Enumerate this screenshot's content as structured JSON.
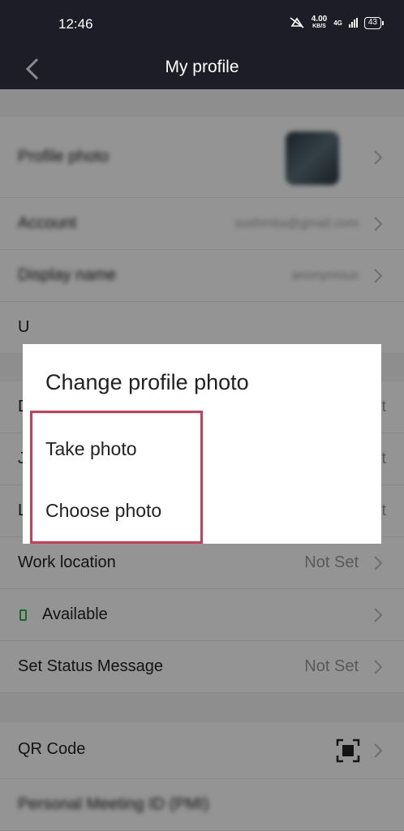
{
  "status_bar": {
    "time": "12:46",
    "speed_value": "4.00",
    "speed_unit": "KB/S",
    "network": "4G",
    "battery": "43"
  },
  "header": {
    "title": "My profile"
  },
  "profile": {
    "photo_label": "Profile photo",
    "account_label": "Account",
    "account_value": "sushmita@gmail.com",
    "display_name_label": "Display name",
    "display_name_value": "anonymous",
    "u_row_label": "U",
    "d_row_label": "D",
    "d_row_value": "t",
    "j_row_label": "J",
    "j_row_value": "t",
    "l_row_label": "L",
    "l_row_value": "t",
    "work_location_label": "Work location",
    "work_location_value": "Not Set",
    "availability_label": "Available",
    "status_message_label": "Set Status Message",
    "status_message_value": "Not Set",
    "qr_code_label": "QR Code",
    "pmi_label": "Personal Meeting ID (PMI)"
  },
  "dialog": {
    "title": "Change profile photo",
    "options": [
      "Take photo",
      "Choose photo"
    ]
  },
  "colors": {
    "header_bg": "#1d1d27",
    "highlight": "#d23a56",
    "available": "#2fb34a"
  },
  "icons": [
    "back-arrow-icon",
    "chevron-right-icon",
    "qr-code-icon",
    "mute-icon",
    "signal-icon",
    "battery-icon"
  ]
}
